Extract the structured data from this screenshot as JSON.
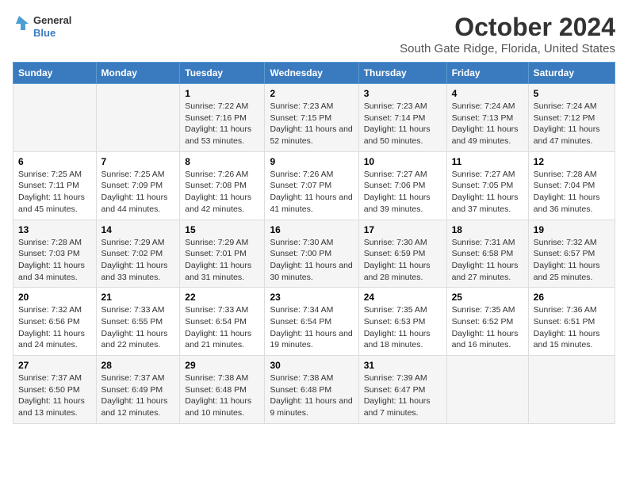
{
  "header": {
    "logo_line1": "General",
    "logo_line2": "Blue",
    "title": "October 2024",
    "subtitle": "South Gate Ridge, Florida, United States"
  },
  "days_of_week": [
    "Sunday",
    "Monday",
    "Tuesday",
    "Wednesday",
    "Thursday",
    "Friday",
    "Saturday"
  ],
  "weeks": [
    [
      {
        "day": "",
        "info": ""
      },
      {
        "day": "",
        "info": ""
      },
      {
        "day": "1",
        "info": "Sunrise: 7:22 AM\nSunset: 7:16 PM\nDaylight: 11 hours and 53 minutes."
      },
      {
        "day": "2",
        "info": "Sunrise: 7:23 AM\nSunset: 7:15 PM\nDaylight: 11 hours and 52 minutes."
      },
      {
        "day": "3",
        "info": "Sunrise: 7:23 AM\nSunset: 7:14 PM\nDaylight: 11 hours and 50 minutes."
      },
      {
        "day": "4",
        "info": "Sunrise: 7:24 AM\nSunset: 7:13 PM\nDaylight: 11 hours and 49 minutes."
      },
      {
        "day": "5",
        "info": "Sunrise: 7:24 AM\nSunset: 7:12 PM\nDaylight: 11 hours and 47 minutes."
      }
    ],
    [
      {
        "day": "6",
        "info": "Sunrise: 7:25 AM\nSunset: 7:11 PM\nDaylight: 11 hours and 45 minutes."
      },
      {
        "day": "7",
        "info": "Sunrise: 7:25 AM\nSunset: 7:09 PM\nDaylight: 11 hours and 44 minutes."
      },
      {
        "day": "8",
        "info": "Sunrise: 7:26 AM\nSunset: 7:08 PM\nDaylight: 11 hours and 42 minutes."
      },
      {
        "day": "9",
        "info": "Sunrise: 7:26 AM\nSunset: 7:07 PM\nDaylight: 11 hours and 41 minutes."
      },
      {
        "day": "10",
        "info": "Sunrise: 7:27 AM\nSunset: 7:06 PM\nDaylight: 11 hours and 39 minutes."
      },
      {
        "day": "11",
        "info": "Sunrise: 7:27 AM\nSunset: 7:05 PM\nDaylight: 11 hours and 37 minutes."
      },
      {
        "day": "12",
        "info": "Sunrise: 7:28 AM\nSunset: 7:04 PM\nDaylight: 11 hours and 36 minutes."
      }
    ],
    [
      {
        "day": "13",
        "info": "Sunrise: 7:28 AM\nSunset: 7:03 PM\nDaylight: 11 hours and 34 minutes."
      },
      {
        "day": "14",
        "info": "Sunrise: 7:29 AM\nSunset: 7:02 PM\nDaylight: 11 hours and 33 minutes."
      },
      {
        "day": "15",
        "info": "Sunrise: 7:29 AM\nSunset: 7:01 PM\nDaylight: 11 hours and 31 minutes."
      },
      {
        "day": "16",
        "info": "Sunrise: 7:30 AM\nSunset: 7:00 PM\nDaylight: 11 hours and 30 minutes."
      },
      {
        "day": "17",
        "info": "Sunrise: 7:30 AM\nSunset: 6:59 PM\nDaylight: 11 hours and 28 minutes."
      },
      {
        "day": "18",
        "info": "Sunrise: 7:31 AM\nSunset: 6:58 PM\nDaylight: 11 hours and 27 minutes."
      },
      {
        "day": "19",
        "info": "Sunrise: 7:32 AM\nSunset: 6:57 PM\nDaylight: 11 hours and 25 minutes."
      }
    ],
    [
      {
        "day": "20",
        "info": "Sunrise: 7:32 AM\nSunset: 6:56 PM\nDaylight: 11 hours and 24 minutes."
      },
      {
        "day": "21",
        "info": "Sunrise: 7:33 AM\nSunset: 6:55 PM\nDaylight: 11 hours and 22 minutes."
      },
      {
        "day": "22",
        "info": "Sunrise: 7:33 AM\nSunset: 6:54 PM\nDaylight: 11 hours and 21 minutes."
      },
      {
        "day": "23",
        "info": "Sunrise: 7:34 AM\nSunset: 6:54 PM\nDaylight: 11 hours and 19 minutes."
      },
      {
        "day": "24",
        "info": "Sunrise: 7:35 AM\nSunset: 6:53 PM\nDaylight: 11 hours and 18 minutes."
      },
      {
        "day": "25",
        "info": "Sunrise: 7:35 AM\nSunset: 6:52 PM\nDaylight: 11 hours and 16 minutes."
      },
      {
        "day": "26",
        "info": "Sunrise: 7:36 AM\nSunset: 6:51 PM\nDaylight: 11 hours and 15 minutes."
      }
    ],
    [
      {
        "day": "27",
        "info": "Sunrise: 7:37 AM\nSunset: 6:50 PM\nDaylight: 11 hours and 13 minutes."
      },
      {
        "day": "28",
        "info": "Sunrise: 7:37 AM\nSunset: 6:49 PM\nDaylight: 11 hours and 12 minutes."
      },
      {
        "day": "29",
        "info": "Sunrise: 7:38 AM\nSunset: 6:48 PM\nDaylight: 11 hours and 10 minutes."
      },
      {
        "day": "30",
        "info": "Sunrise: 7:38 AM\nSunset: 6:48 PM\nDaylight: 11 hours and 9 minutes."
      },
      {
        "day": "31",
        "info": "Sunrise: 7:39 AM\nSunset: 6:47 PM\nDaylight: 11 hours and 7 minutes."
      },
      {
        "day": "",
        "info": ""
      },
      {
        "day": "",
        "info": ""
      }
    ]
  ]
}
